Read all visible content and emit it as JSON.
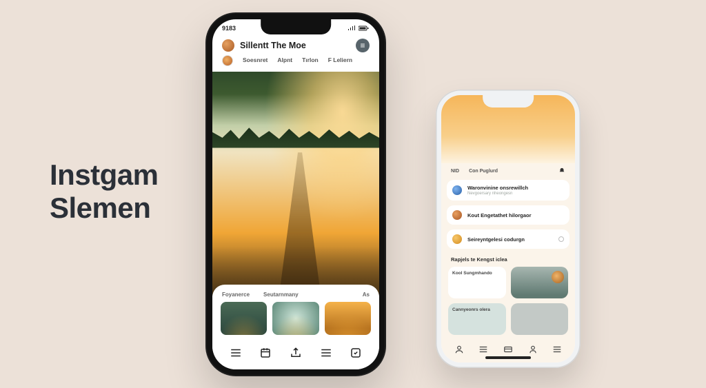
{
  "headline": {
    "line1": "Instgam",
    "line2": "Slemen"
  },
  "phoneA": {
    "time": "9183",
    "title": "Sillentt The Moe",
    "tabs": [
      "Soesnret",
      "Alpnt",
      "Tırlon",
      "F Leliern"
    ],
    "panelLabels": [
      "Foyanerce",
      "Seutarnmany",
      "As"
    ],
    "nav": [
      "menu",
      "calendar",
      "share",
      "menu2",
      "bookmark"
    ]
  },
  "phoneB": {
    "breadcrumbLeft": "NID",
    "breadcrumbRight": "Con Puglurd",
    "rows": [
      {
        "title": "Waronvinine onsrewillch",
        "sub": "Nevgoersary nheongesn"
      },
      {
        "title": "Kout Engetathet hilorgaor",
        "sub": ""
      },
      {
        "title": "Seireyntgelesi codurgn",
        "sub": ""
      }
    ],
    "section": "Rapjels te Kengst iclea",
    "tiles": [
      "Kool Sungmhando",
      "",
      "Cannyeonrs olera",
      ""
    ],
    "nav": [
      "person",
      "menu",
      "card",
      "user",
      "add"
    ]
  }
}
